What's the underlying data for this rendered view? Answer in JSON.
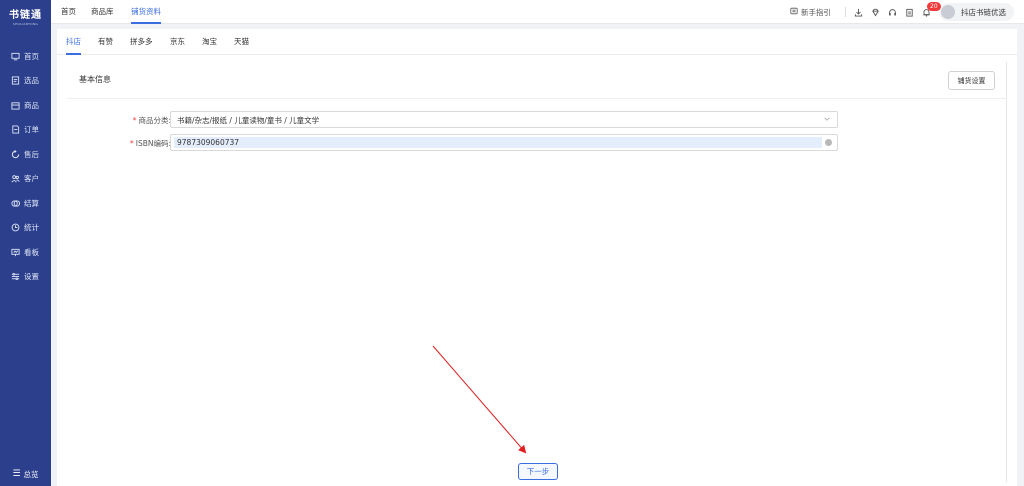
{
  "logo": {
    "title": "书链通",
    "subtitle": "SHULIANTONG"
  },
  "sidebar": {
    "items": [
      {
        "label": "首页",
        "icon": "monitor-icon"
      },
      {
        "label": "选品",
        "icon": "select-icon"
      },
      {
        "label": "商品",
        "icon": "goods-icon"
      },
      {
        "label": "订单",
        "icon": "order-icon"
      },
      {
        "label": "售后",
        "icon": "after-sale-icon"
      },
      {
        "label": "客户",
        "icon": "customer-icon"
      },
      {
        "label": "结算",
        "icon": "settle-icon"
      },
      {
        "label": "统计",
        "icon": "stats-icon"
      },
      {
        "label": "看板",
        "icon": "dashboard-icon"
      },
      {
        "label": "设置",
        "icon": "settings-icon"
      }
    ],
    "collapse_label": "总览"
  },
  "topbar": {
    "tabs": [
      {
        "label": "首页"
      },
      {
        "label": "商品库"
      },
      {
        "label": "铺货资料"
      }
    ],
    "guide_label": "新手指引",
    "badge_count": "20",
    "user_name": "抖店书链优选"
  },
  "platform_tabs": [
    {
      "label": "抖店"
    },
    {
      "label": "有赞"
    },
    {
      "label": "拼多多"
    },
    {
      "label": "京东"
    },
    {
      "label": "淘宝"
    },
    {
      "label": "天猫"
    }
  ],
  "card": {
    "title": "基本信息",
    "setting_button": "铺货设置"
  },
  "form": {
    "category": {
      "label": "商品分类:",
      "value": "书籍/杂志/报纸 / 儿童读物/童书 / 儿童文学"
    },
    "isbn": {
      "label": "ISBN编码:",
      "value": "9787309060737"
    }
  },
  "next_button": "下一步",
  "colors": {
    "sidebar": "#2b3f8c",
    "accent": "#3a6de0",
    "annotation_arrow": "#e02020"
  }
}
